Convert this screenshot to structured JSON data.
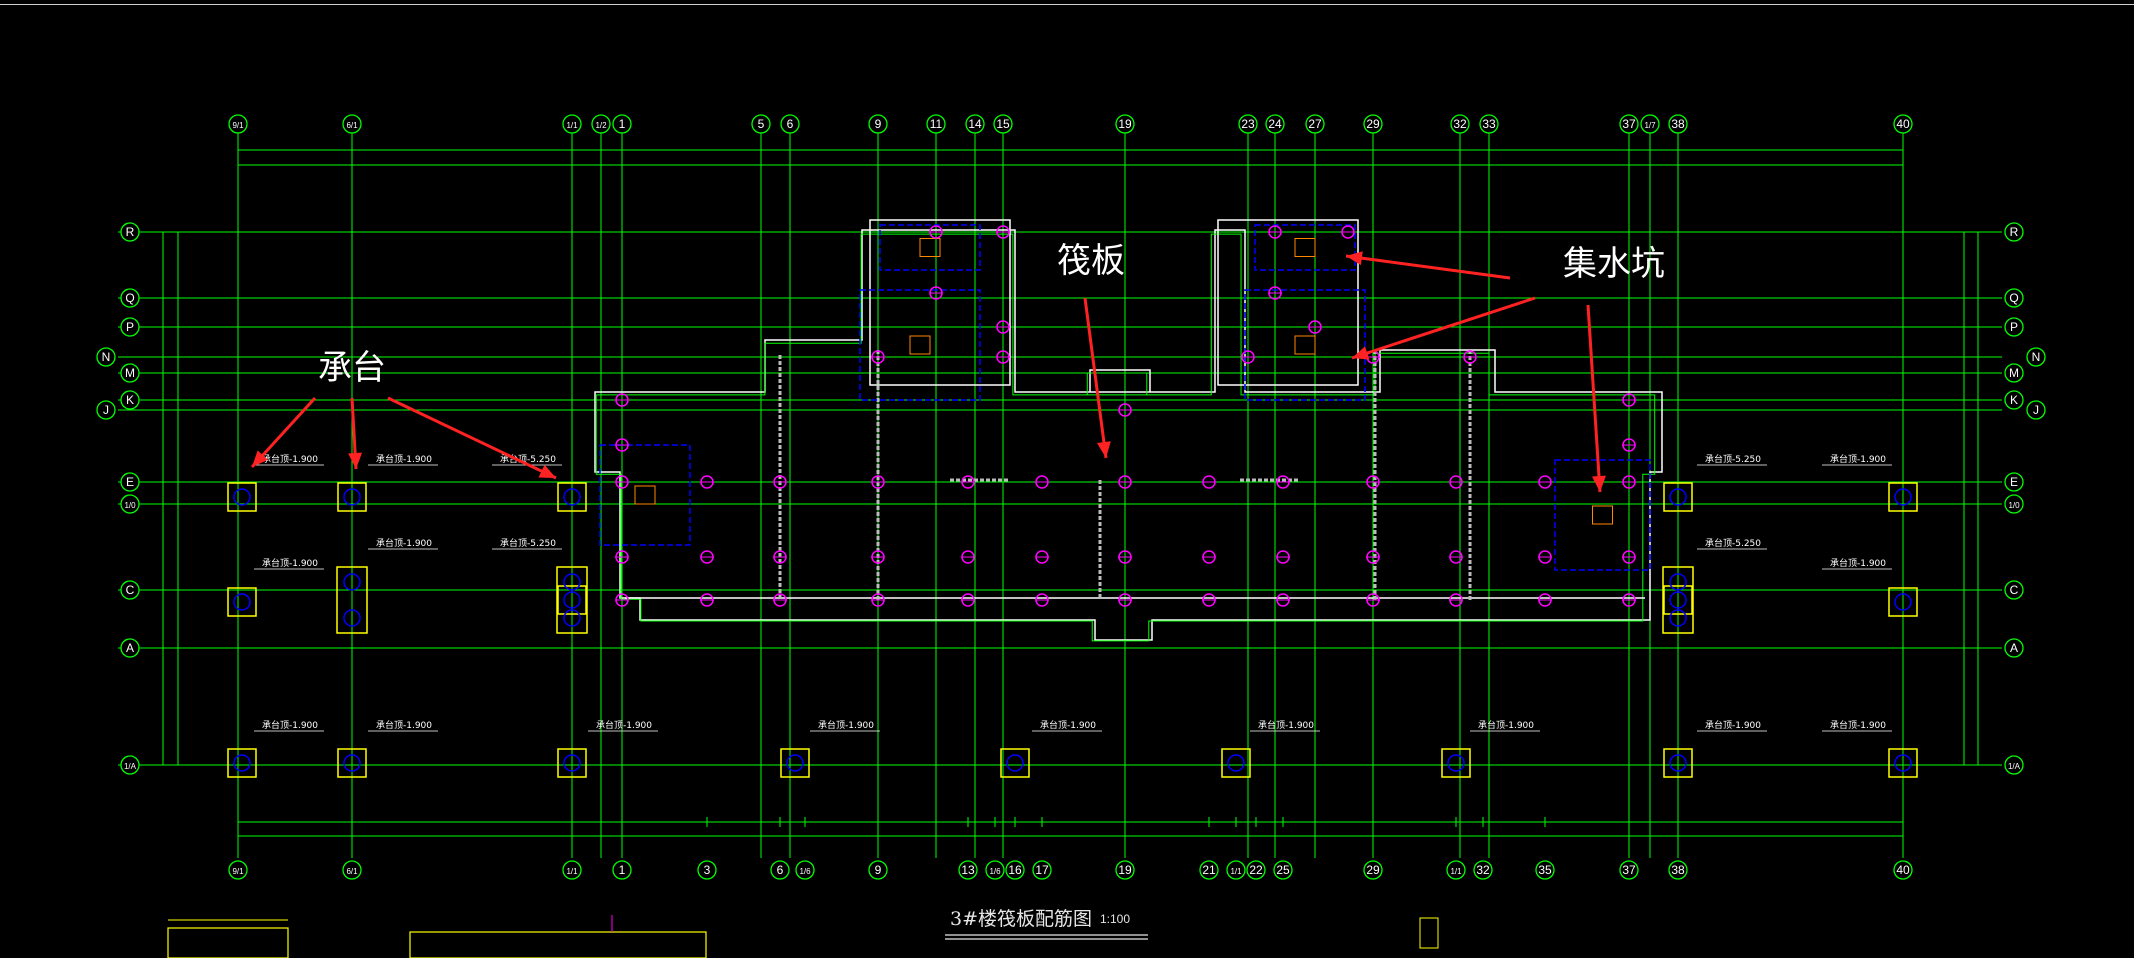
{
  "annotations": {
    "cap": "承台",
    "raft": "筏板",
    "sump": "集水坑"
  },
  "sheet": {
    "title": "3#楼筏板配筋图",
    "scale": "1:100"
  },
  "axes": {
    "top": [
      "9/1",
      "6/1",
      "1/1",
      "1/2",
      "1",
      "5",
      "6",
      "9",
      "11",
      "14",
      "15",
      "19",
      "23",
      "24",
      "27",
      "29",
      "32",
      "33",
      "37",
      "1/7",
      "38",
      "40"
    ],
    "bottom": [
      "9/1",
      "6/1",
      "1/1",
      "1",
      "3",
      "6",
      "1/6",
      "9",
      "13",
      "1/6",
      "16",
      "17",
      "19",
      "21",
      "1/1",
      "22",
      "25",
      "29",
      "1/1",
      "32",
      "35",
      "37",
      "38",
      "40"
    ],
    "left": [
      "R",
      "Q",
      "P",
      "N",
      "M",
      "K",
      "J",
      "E",
      "1/0",
      "C",
      "A",
      "1/A"
    ],
    "right": [
      "R",
      "Q",
      "P",
      "N",
      "M",
      "K",
      "J",
      "E",
      "1/0",
      "C",
      "A",
      "1/A"
    ]
  },
  "cap_labels": {
    "t1900": "承台顶-1.900",
    "t5250": "承台顶-5.250"
  },
  "colors": {
    "background": "#000000",
    "grid": "#00ff00",
    "wall": "#ffffff",
    "column": "#ff00ff",
    "cap": "#ffff00",
    "pile": "#0000ff",
    "dimension": "#00ffff",
    "arrow": "#ff2222",
    "callout_text": "#ffffff"
  }
}
